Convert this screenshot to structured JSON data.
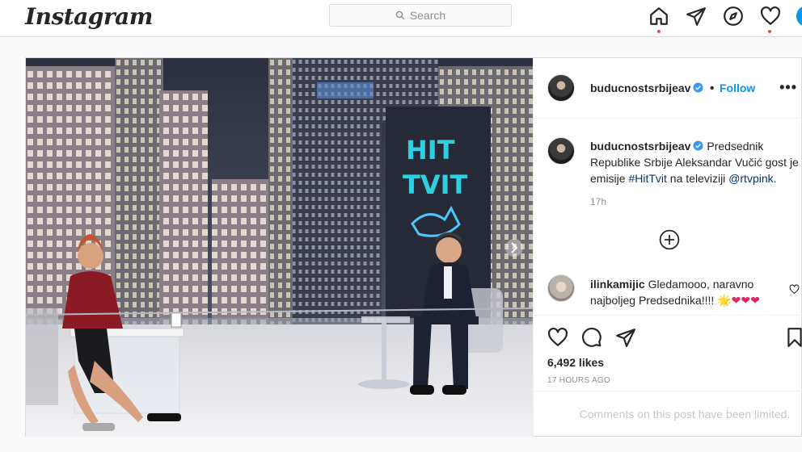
{
  "topbar": {
    "logo": "Instagram",
    "search_placeholder": "Search",
    "icons": [
      "home-icon",
      "direct-icon",
      "explore-icon",
      "activity-heart-icon",
      "profile-avatar"
    ]
  },
  "post": {
    "photo": {
      "sign_line1": "HIT",
      "sign_line2": "TVIT"
    },
    "header": {
      "username": "buducnostsrbijeav",
      "separator": "•",
      "follow_label": "Follow",
      "more_label": "•••"
    },
    "caption": {
      "username": "buducnostsrbijeav",
      "text_before": " Predsednik Republike Srbije Aleksandar Vučić gost je emisije ",
      "hashtag": "#HitTvit",
      "text_middle": " na televiziji ",
      "mention": "@rtvpink",
      "text_after": ".",
      "time": "17h"
    },
    "comment": {
      "username": "ilinkamijic",
      "text": " Gledamooo, naravno najboljeg Predsednika!!!! ",
      "emoji": "🌟❤❤❤"
    },
    "likes": "6,492 likes",
    "posted_ago": "17 HOURS AGO",
    "comments_limited": "Comments on this post have been limited."
  },
  "colors": {
    "accent": "#0095f6",
    "notification": "#ed4956",
    "link": "#00376b",
    "muted": "#8e8e8e"
  }
}
